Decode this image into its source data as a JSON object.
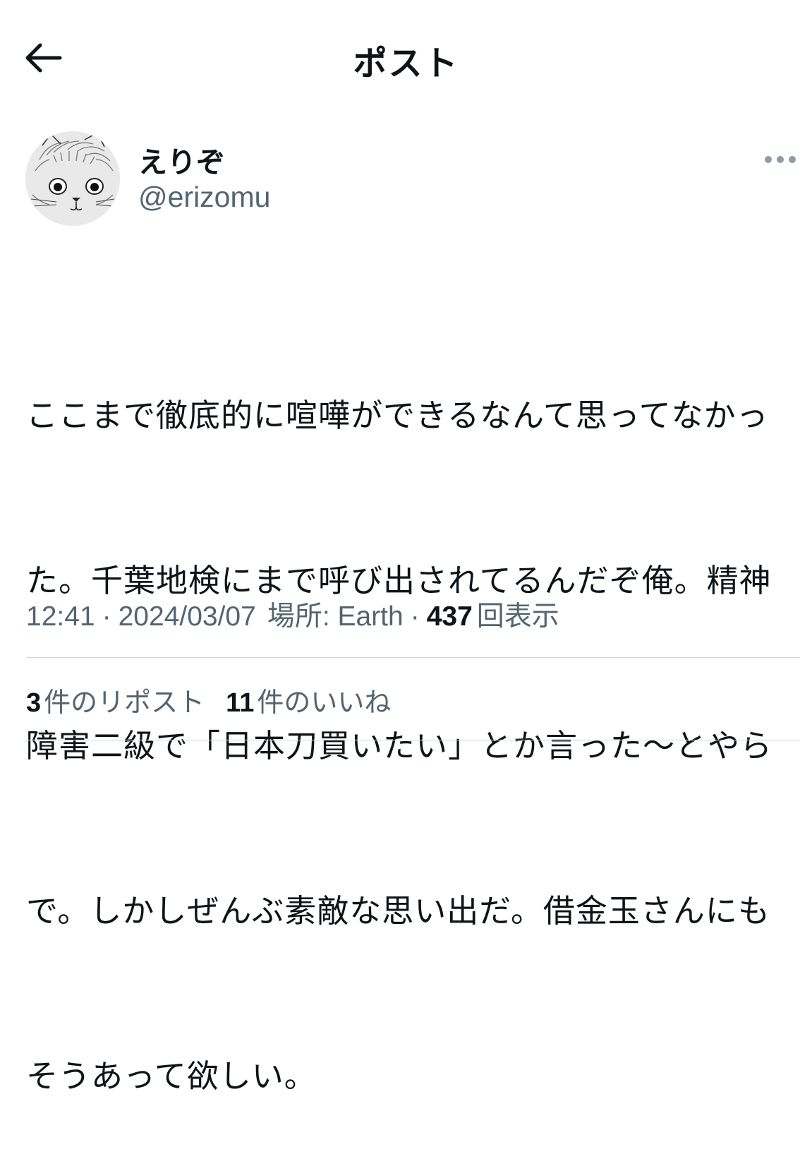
{
  "header": {
    "title": "ポスト",
    "back_icon": "arrow-left-icon"
  },
  "author": {
    "display_name": "えりぞ",
    "handle": "@erizomu",
    "avatar_icon": "cat-drawing-avatar"
  },
  "more_icon": "more-horizontal-icon",
  "post": {
    "lines": [
      "ここまで徹底的に喧嘩ができるなんて思ってなかっ",
      "た。千葉地検にまで呼び出されてるんだぞ俺。精神",
      "障害二級で「日本刀買いたい」とか言った〜とやら",
      "で。しかしぜんぶ素敵な思い出だ。借金玉さんにも",
      "そうあって欲しい。"
    ]
  },
  "meta": {
    "time": "12:41",
    "separator": "·",
    "date": "2024/03/07",
    "location": "場所: Earth",
    "views_count": "437",
    "views_label": "回表示"
  },
  "stats": {
    "reposts_count": "3",
    "reposts_label": "件のリポスト",
    "likes_count": "11",
    "likes_label": "件のいいね"
  },
  "colors": {
    "text": "#0f1419",
    "secondary": "#536471",
    "divider": "#cfd9de"
  }
}
